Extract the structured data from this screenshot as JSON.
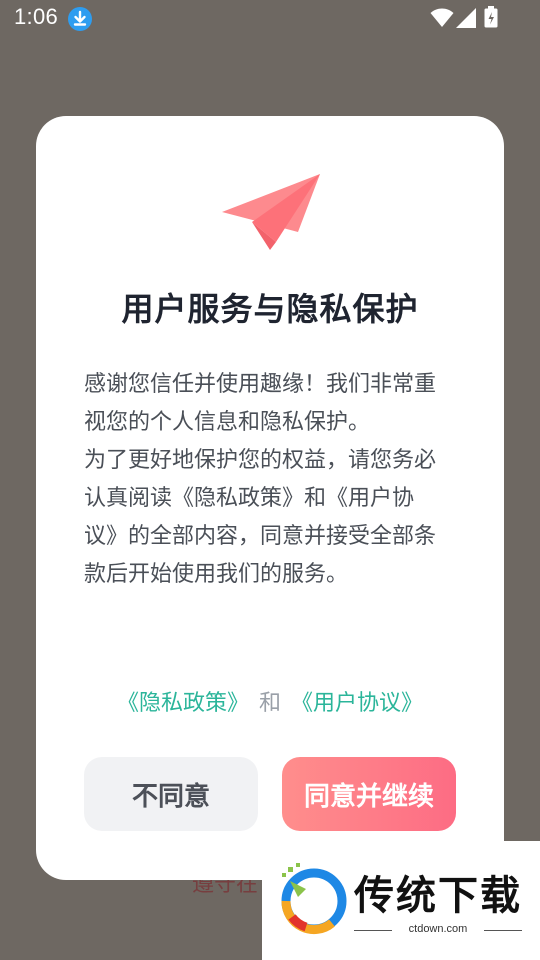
{
  "status_bar": {
    "time": "1:06",
    "icons": [
      "download-icon",
      "wifi-icon",
      "signal-icon",
      "battery-icon"
    ]
  },
  "background": {
    "behind_text": "遵守在"
  },
  "dialog": {
    "icon": "paper-plane-icon",
    "title": "用户服务与隐私保护",
    "body_paragraphs": [
      "感谢您信任并使用趣缘！我们非常重视您的个人信息和隐私保护。",
      "为了更好地保护您的权益，请您务必认真阅读《隐私政策》和《用户协议》的全部内容，同意并接受全部条款后开始使用我们的服务。"
    ],
    "privacy_link": "《隐私政策》",
    "link_separator": "和",
    "user_agreement_link": "《用户协议》",
    "disagree_button": "不同意",
    "agree_button": "同意并继续"
  },
  "watermark": {
    "brand": "传统下载",
    "url": "ctdown.com"
  },
  "colors": {
    "overlay": "#6e6862",
    "accent_link": "#2bb59a",
    "agree_gradient_start": "#ff8e8c",
    "agree_gradient_end": "#fd6c84",
    "plane": "#fd8a8e"
  }
}
